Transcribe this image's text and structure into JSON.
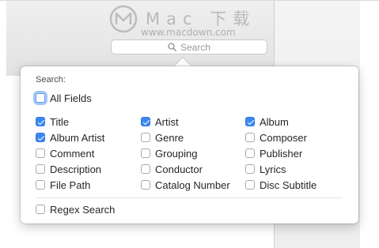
{
  "watermark": {
    "title": "Mac 下载",
    "url": "www.macdown.com"
  },
  "search": {
    "placeholder": "Search",
    "icon": "search-icon"
  },
  "popover": {
    "label": "Search:",
    "all_fields": {
      "label": "All Fields",
      "checked": false
    },
    "fields": [
      {
        "label": "Title",
        "checked": true
      },
      {
        "label": "Artist",
        "checked": true
      },
      {
        "label": "Album",
        "checked": true
      },
      {
        "label": "Album Artist",
        "checked": true
      },
      {
        "label": "Genre",
        "checked": false
      },
      {
        "label": "Composer",
        "checked": false
      },
      {
        "label": "Comment",
        "checked": false
      },
      {
        "label": "Grouping",
        "checked": false
      },
      {
        "label": "Publisher",
        "checked": false
      },
      {
        "label": "Description",
        "checked": false
      },
      {
        "label": "Conductor",
        "checked": false
      },
      {
        "label": "Lyrics",
        "checked": false
      },
      {
        "label": "File Path",
        "checked": false
      },
      {
        "label": "Catalog Number",
        "checked": false
      },
      {
        "label": "Disc Subtitle",
        "checked": false
      }
    ],
    "regex": {
      "label": "Regex Search",
      "checked": false
    }
  },
  "colors": {
    "accent": "#3b88f3",
    "focus_ring": "#5a96f0"
  }
}
